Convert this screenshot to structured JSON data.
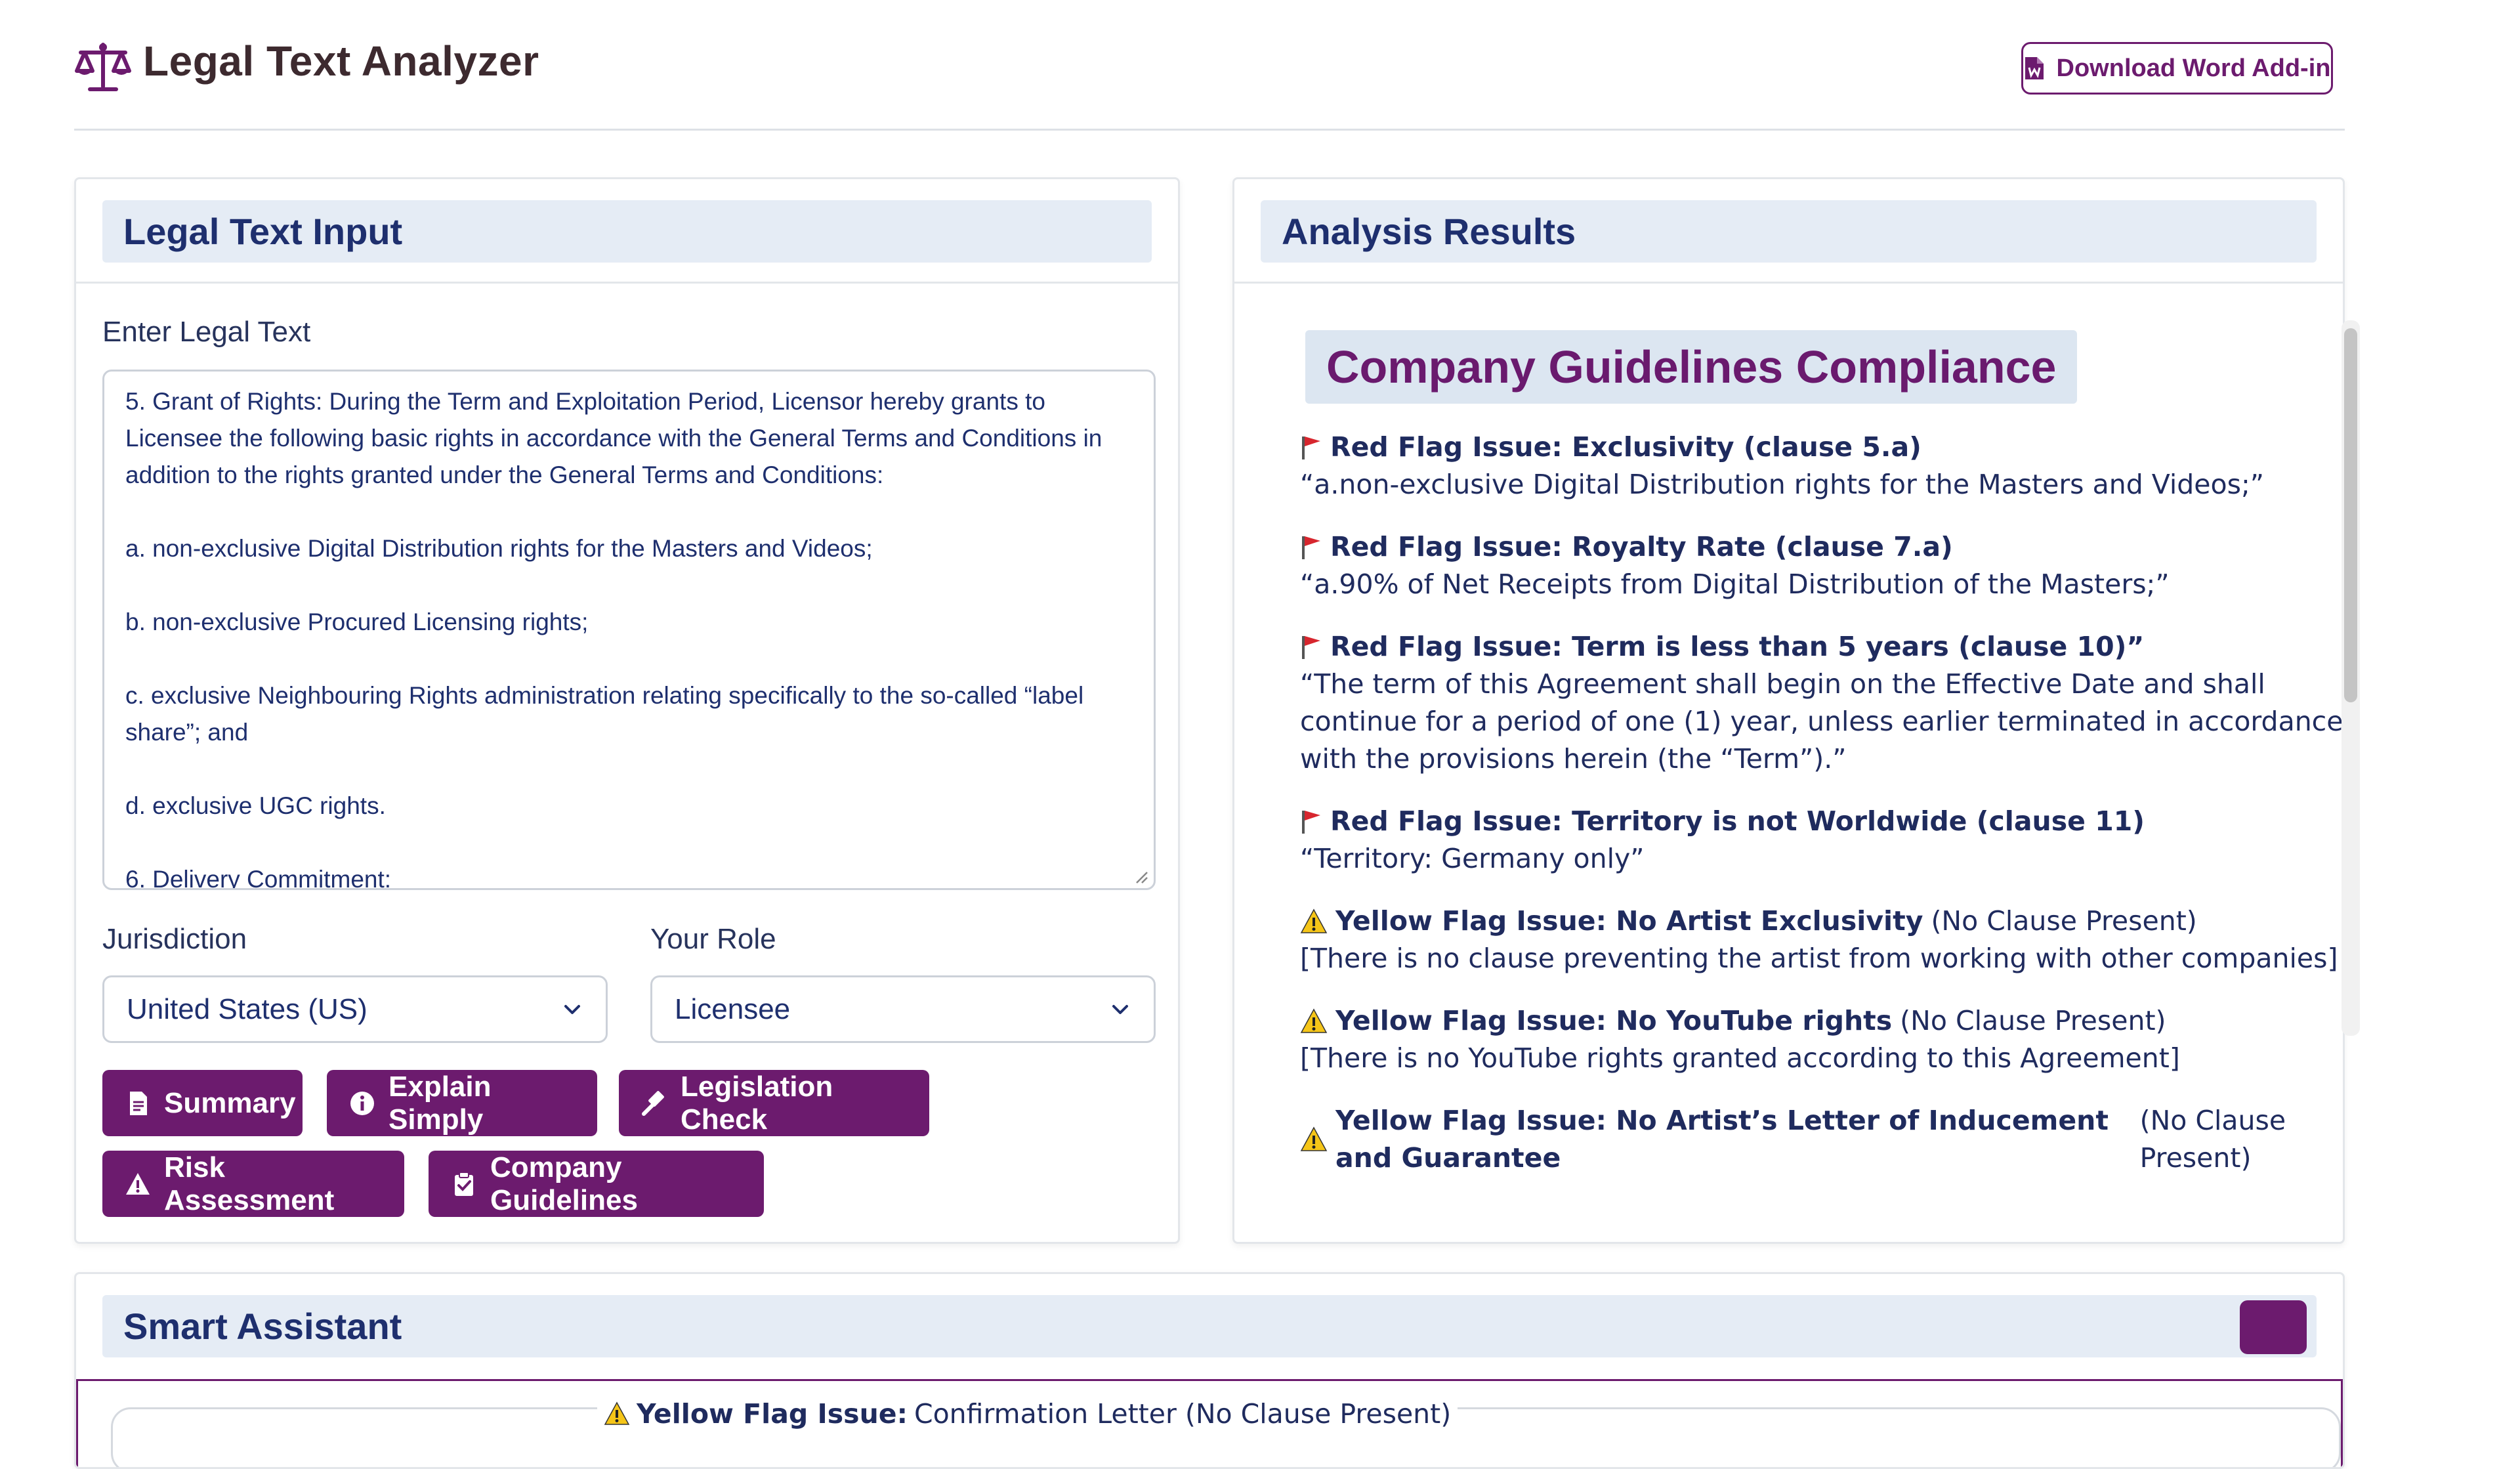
{
  "app": {
    "title": "Legal Text Analyzer",
    "download_label": "Download Word Add-in",
    "logo_icon": "balance-scale-icon",
    "accent_color": "#6c1b6e"
  },
  "input_panel": {
    "title": "Legal Text Input",
    "text_label": "Enter Legal Text",
    "text_value": "5. Grant of Rights: During the Term and Exploitation Period, Licensor hereby grants to Licensee the following basic rights in accordance with the General Terms and Conditions in addition to the rights granted under the General Terms and Conditions:\n\na. non-exclusive Digital Distribution rights for the Masters and Videos;\n\nb. non-exclusive Procured Licensing rights;\n\nc. exclusive Neighbouring Rights administration relating specifically to the so-called “label share”; and\n\nd. exclusive UGC rights.\n\n6. Delivery Commitment:",
    "jurisdiction_label": "Jurisdiction",
    "jurisdiction_value": "United States (US)",
    "role_label": "Your Role",
    "role_value": "Licensee",
    "buttons": {
      "summary": "Summary",
      "explain": "Explain Simply",
      "legislation": "Legislation Check",
      "risk": "Risk Assessment",
      "guidelines": "Company Guidelines"
    }
  },
  "results_panel": {
    "title": "Analysis Results",
    "section_title": "Company Guidelines Compliance",
    "issues": [
      {
        "flag": "red",
        "title": "Red Flag Issue:  Exclusivity (clause 5.a)",
        "note": "",
        "quote": "“a.non-exclusive Digital Distribution rights for the Masters and Videos;”"
      },
      {
        "flag": "red",
        "title": "Red Flag Issue: Royalty Rate (clause 7.a)",
        "note": "",
        "quote": "“a.90% of Net Receipts from Digital Distribution of the Masters;”"
      },
      {
        "flag": "red",
        "title": "Red Flag Issue: Term is less than 5 years (clause 10)”",
        "note": "",
        "quote": "“The term of this Agreement shall begin on the Effective Date and shall continue for a period of one (1) year, unless earlier terminated in accordance with the provisions herein (the “Term”).”"
      },
      {
        "flag": "red",
        "title": "Red Flag Issue: Territory is not Worldwide (clause 11)",
        "note": "",
        "quote": "“Territory: Germany only”"
      },
      {
        "flag": "yellow",
        "title": "Yellow Flag Issue: No Artist Exclusivity",
        "note": "(No Clause Present)",
        "quote": "[There is no clause preventing the artist from working with other companies]"
      },
      {
        "flag": "yellow",
        "title": "Yellow Flag Issue: No YouTube rights",
        "note": "(No Clause Present)",
        "quote": "[There is no YouTube rights granted according to this Agreement]"
      },
      {
        "flag": "yellow",
        "title": "Yellow Flag Issue: No Artist’s Letter of Inducement and Guarantee",
        "note": "(No Clause Present)",
        "quote": ""
      }
    ]
  },
  "assistant": {
    "title": "Smart Assistant",
    "preview_bold": "Yellow Flag Issue:",
    "preview_rest": "Confirmation Letter (No Clause Present)"
  }
}
